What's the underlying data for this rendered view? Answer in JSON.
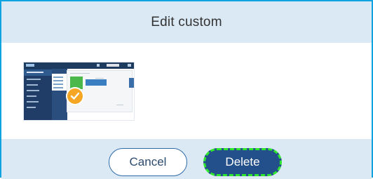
{
  "dialog": {
    "title": "Edit custom",
    "cancel_label": "Cancel",
    "delete_label": "Delete"
  },
  "thumbnail": {
    "selected": true,
    "check_icon": "check-circle-icon"
  },
  "colors": {
    "header_bg": "#dbe9f5",
    "frame": "#0fa3e0",
    "primary": "#23508a",
    "focus_ring": "#2ee82e",
    "check": "#f5a623"
  }
}
